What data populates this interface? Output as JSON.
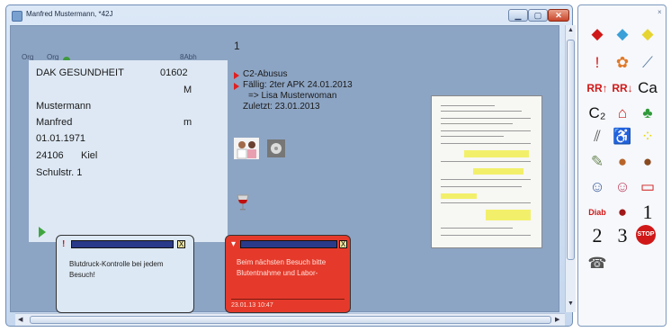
{
  "window": {
    "title": "Manfred Mustermann, *42J",
    "minimize_glyph": "▁",
    "maximize_glyph": "▢",
    "close_glyph": "✕"
  },
  "patient_card": {
    "labels": [
      "Org",
      "Org",
      "8Abh"
    ],
    "insurance": "DAK GESUNDHEIT",
    "insurance_code": "01602",
    "status": "M",
    "last_name": "Mustermann",
    "first_name": "Manfred",
    "sex": "m",
    "birth_date": "01.01.1971",
    "zip": "24106",
    "city": "Kiel",
    "street": "Schulstr. 1"
  },
  "counter": "1",
  "info": {
    "line1": "C2-Abusus",
    "line2": "Fällig: 2ter APK 24.01.2013",
    "line3": "=> Lisa Musterwoman",
    "line4": "Zuletzt: 23.01.2013"
  },
  "messages": [
    {
      "text": "Blutdruck-Kontrolle bei jedem Besuch!",
      "close": "X",
      "accent": "#2a3a8a"
    },
    {
      "text": "Beim nächsten Besuch bitte Blutentnahme und Labor-",
      "date": "23.01.13 10:47",
      "close": "X",
      "accent": "#2a3a8a"
    }
  ],
  "panel": {
    "close_glyph": "×",
    "icons": [
      {
        "name": "red-note-icon",
        "glyph": "◆",
        "color": "#d01818"
      },
      {
        "name": "blue-note-icon",
        "glyph": "◆",
        "color": "#3aa0d8"
      },
      {
        "name": "yellow-note-icon",
        "glyph": "◆",
        "color": "#e6d431"
      },
      {
        "name": "exclamation-icon",
        "glyph": "!",
        "color": "#d01818"
      },
      {
        "name": "flower-icon",
        "glyph": "✿",
        "color": "#e07a2a"
      },
      {
        "name": "syringe-icon",
        "glyph": "⟋",
        "color": "#5a7aa0"
      },
      {
        "name": "rr-up-icon",
        "glyph": "RR↑",
        "color": "#d01818"
      },
      {
        "name": "rr-down-icon",
        "glyph": "RR↓",
        "color": "#d01818"
      },
      {
        "name": "calcium-icon",
        "glyph": "Ca",
        "color": "#111111"
      },
      {
        "name": "c2-icon",
        "glyph": "C₂",
        "color": "#111111"
      },
      {
        "name": "house-icon",
        "glyph": "⌂",
        "color": "#d01818"
      },
      {
        "name": "clover-icon",
        "glyph": "♣",
        "color": "#2f9a3a"
      },
      {
        "name": "crutches-icon",
        "glyph": "⫽",
        "color": "#555555"
      },
      {
        "name": "wheelchair-icon",
        "glyph": "♿",
        "color": "#222222"
      },
      {
        "name": "blind-icon",
        "glyph": "⁘",
        "color": "#e8d800"
      },
      {
        "name": "pen-icon",
        "glyph": "✎",
        "color": "#6f8a5a"
      },
      {
        "name": "bird-icon",
        "glyph": "●",
        "color": "#b8642a"
      },
      {
        "name": "turkey-icon",
        "glyph": "●",
        "color": "#8a4a20"
      },
      {
        "name": "doctor-icon",
        "glyph": "☺",
        "color": "#3a5a9a"
      },
      {
        "name": "nurse-icon",
        "glyph": "☺",
        "color": "#c04060"
      },
      {
        "name": "tube-icon",
        "glyph": "▭",
        "color": "#d01818"
      },
      {
        "name": "diab-icon",
        "glyph": "Diab",
        "color": "#d01818"
      },
      {
        "name": "turtle-icon",
        "glyph": "●",
        "color": "#a01818"
      },
      {
        "name": "one-icon",
        "glyph": "1",
        "color": "#111111"
      },
      {
        "name": "two-icon",
        "glyph": "2",
        "color": "#111111"
      },
      {
        "name": "three-icon",
        "glyph": "3",
        "color": "#111111"
      },
      {
        "name": "stop-icon",
        "glyph": "STOP",
        "color": "#d01818"
      },
      {
        "name": "phone-icon",
        "glyph": "☎",
        "color": "#555555"
      }
    ]
  }
}
